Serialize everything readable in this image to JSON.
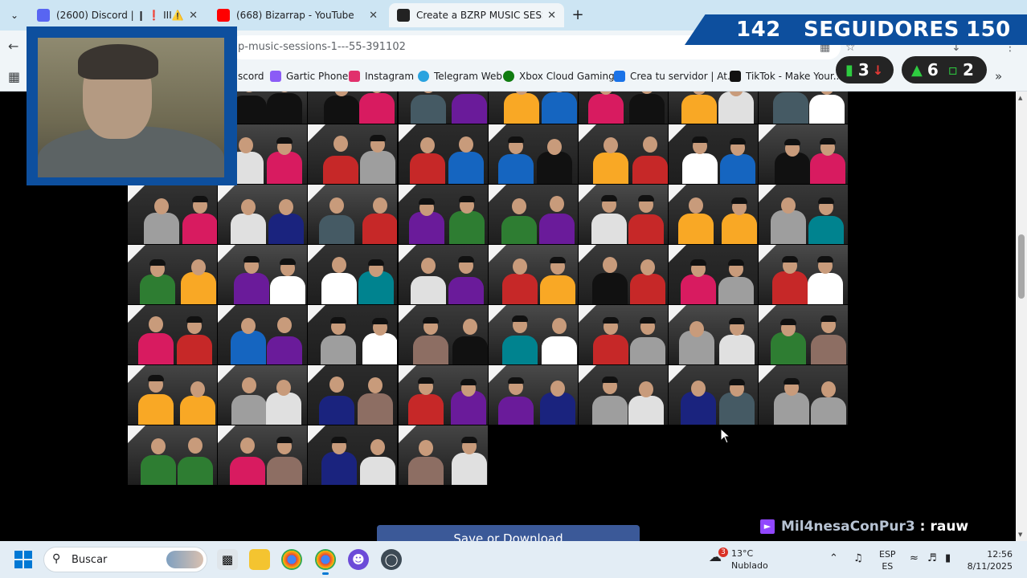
{
  "tabs": [
    {
      "title": "(2600) Discord | ❙ ❗ ΙΙΙ⚠️",
      "icon": "discord-icon",
      "color": "#5865F2",
      "active": false
    },
    {
      "title": "(668) Bizarrap - YouTube",
      "icon": "youtube-icon",
      "color": "#FF0000",
      "active": false
    },
    {
      "title": "Create a BZRP MUSIC SESSION",
      "icon": "bzrp-icon",
      "color": "#222222",
      "active": true
    }
  ],
  "toolbar": {
    "url": "p-music-sessions-1---55-391102"
  },
  "bookmarks": [
    {
      "label": "scord",
      "color": "#5865F2"
    },
    {
      "label": "Gartic Phone",
      "color": "#8b5cf6"
    },
    {
      "label": "Instagram",
      "color": "#e1306c"
    },
    {
      "label": "Telegram Web",
      "color": "#2aa3df"
    },
    {
      "label": "Xbox Cloud Gaming",
      "color": "#107c10"
    },
    {
      "label": "Crea tu servidor | At...",
      "color": "#1a73e8"
    },
    {
      "label": "TikTok - Make Your...",
      "color": "#111111"
    }
  ],
  "page": {
    "save_button": "Save or Download"
  },
  "overlay": {
    "followers_current": "142",
    "followers_label": "SEGUIDORES",
    "followers_goal": "150",
    "stat1": "3",
    "stat2": "6",
    "stat3": "2",
    "chat_user": "Mil4nesaConPur3",
    "chat_sep": ":",
    "chat_msg": "rauw"
  },
  "taskbar": {
    "search_placeholder": "Buscar",
    "weather_temp": "13°C",
    "weather_desc": "Nublado",
    "weather_badge": "3",
    "lang_top": "ESP",
    "lang_bottom": "ES",
    "time": "12:56",
    "date": "8/11/2025"
  },
  "colors": {
    "overlay_blue": "#0d4f9e",
    "button_blue": "#3b5998",
    "tab_strip": "#cde5f3"
  }
}
